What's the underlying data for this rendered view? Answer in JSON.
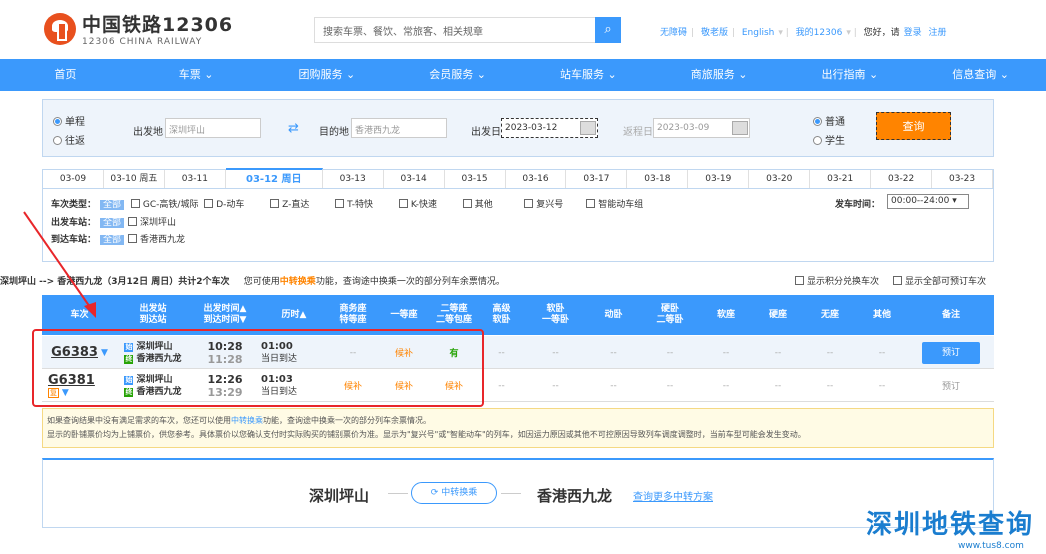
{
  "header": {
    "logo_cn": "中国铁路12306",
    "logo_en": "12306 CHINA RAILWAY",
    "search_placeholder": "搜索车票、餐饮、常旅客、相关规章",
    "links": [
      "无障碍",
      "敬老版",
      "English",
      "我的12306"
    ],
    "greeting": "您好，请",
    "login": "登录",
    "register": "注册"
  },
  "nav": [
    "首页",
    "车票",
    "团购服务",
    "会员服务",
    "站车服务",
    "商旅服务",
    "出行指南",
    "信息查询"
  ],
  "query": {
    "oneway": "单程",
    "roundtrip": "往返",
    "from_label": "出发地",
    "from_value": "深圳坪山",
    "to_label": "目的地",
    "to_value": "香港西九龙",
    "date_label": "出发日",
    "date_value": "2023-03-12",
    "return_label": "返程日",
    "return_value": "2023-03-09",
    "normal": "普通",
    "student": "学生",
    "search_button": "查询"
  },
  "dates": [
    "03-09",
    "03-10 周五",
    "03-11",
    "03-12 周日",
    "03-13",
    "03-14",
    "03-15",
    "03-16",
    "03-17",
    "03-18",
    "03-19",
    "03-20",
    "03-21",
    "03-22",
    "03-23"
  ],
  "filters": {
    "type_label": "车次类型：",
    "all": "全部",
    "types": [
      "GC-高铁/城际",
      "D-动车",
      "Z-直达",
      "T-特快",
      "K-快速",
      "其他",
      "复兴号",
      "智能动车组"
    ],
    "dep_label": "出发车站：",
    "dep_station": "深圳坪山",
    "arr_label": "到达车站：",
    "arr_station": "香港西九龙",
    "time_label": "发车时间：",
    "time_value": "00:00--24:00"
  },
  "summary": {
    "route": "深圳坪山 --> 香港西九龙（3月12日 周日）共计2个车次",
    "hint1": "您可使用",
    "hint_link": "中转换乘",
    "hint2": "功能，查询途中换乘一次的部分列车余票情况。",
    "opt1": "显示积分兑换车次",
    "opt2": "显示全部可预订车次"
  },
  "table": {
    "headers": [
      "车次",
      "出发站\n到达站",
      "出发时间▲\n到达时间▼",
      "历时▲",
      "商务座\n特等座",
      "一等座",
      "二等座\n二等包座",
      "高级\n软卧",
      "软卧\n一等卧",
      "动卧",
      "硬卧\n二等卧",
      "软座",
      "硬座",
      "无座",
      "其他",
      "备注"
    ],
    "rows": [
      {
        "train": "G6383",
        "from": "深圳坪山",
        "to": "香港西九龙",
        "dep": "10:28",
        "arr": "11:28",
        "dur": "01:00",
        "dur_note": "当日到达",
        "seats": [
          "--",
          "候补",
          "有",
          "--",
          "--",
          "--",
          "--",
          "--",
          "--",
          "--",
          "--"
        ],
        "action": "预订"
      },
      {
        "train": "G6381",
        "badge": "复",
        "from": "深圳坪山",
        "to": "香港西九龙",
        "dep": "12:26",
        "arr": "13:29",
        "dur": "01:03",
        "dur_note": "当日到达",
        "seats": [
          "候补",
          "候补",
          "候补",
          "--",
          "--",
          "--",
          "--",
          "--",
          "--",
          "--",
          "--"
        ],
        "action": "预订"
      }
    ]
  },
  "notice": {
    "line1a": "如果查询结果中没有满足需求的车次，您还可以使用",
    "link": "中转换乘",
    "line1b": "功能，查询途中换乘一次的部分列车余票情况。",
    "line2": "显示的卧铺票价均为上铺票价，供您参考。具体票价以您确认支付时实际购买的铺别票价为准。显示为\"复兴号\"或\"智能动车\"的列车，如因运力原因或其他不可控原因导致列车调度调整时，当前车型可能会发生变动。"
  },
  "transfer": {
    "from": "深圳坪山",
    "to": "香港西九龙",
    "button": "中转换乘",
    "link": "查询更多中转方案"
  },
  "watermark": {
    "text": "深圳地铁查询",
    "url": "www.tus8.com"
  },
  "colors": {
    "primary": "#3b99fc",
    "orange": "#ff8400",
    "highlight": "#e8262a"
  }
}
